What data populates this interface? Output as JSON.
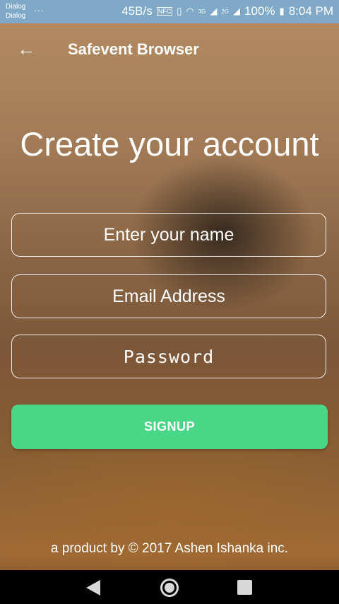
{
  "status_bar": {
    "carrier_line1": "Dialog",
    "carrier_line2": "Dialog",
    "overflow": "...",
    "net_speed": "45B/s",
    "nfc": "NFC",
    "vibrate_icon": "vibrate-icon",
    "wifi_icon": "wifi-icon",
    "signal_3g": "3G",
    "signal_2g": "2G",
    "battery": "100%",
    "time": "8:04 PM"
  },
  "app_bar": {
    "back_icon": "arrow-left-icon",
    "title": "Safevent Browser"
  },
  "form": {
    "heading": "Create your account",
    "name_placeholder": "Enter your name",
    "email_placeholder": "Email Address",
    "password_placeholder": "Password",
    "signup_label": "SIGNUP"
  },
  "footer": {
    "text": "a product by © 2017 Ashen Ishanka inc."
  },
  "colors": {
    "status_bar": "#7fa9c7",
    "signup_button": "#49d787",
    "text": "#ffffff"
  },
  "nav_bar": {
    "back_icon": "nav-back-icon",
    "home_icon": "nav-home-icon",
    "recents_icon": "nav-recents-icon"
  }
}
